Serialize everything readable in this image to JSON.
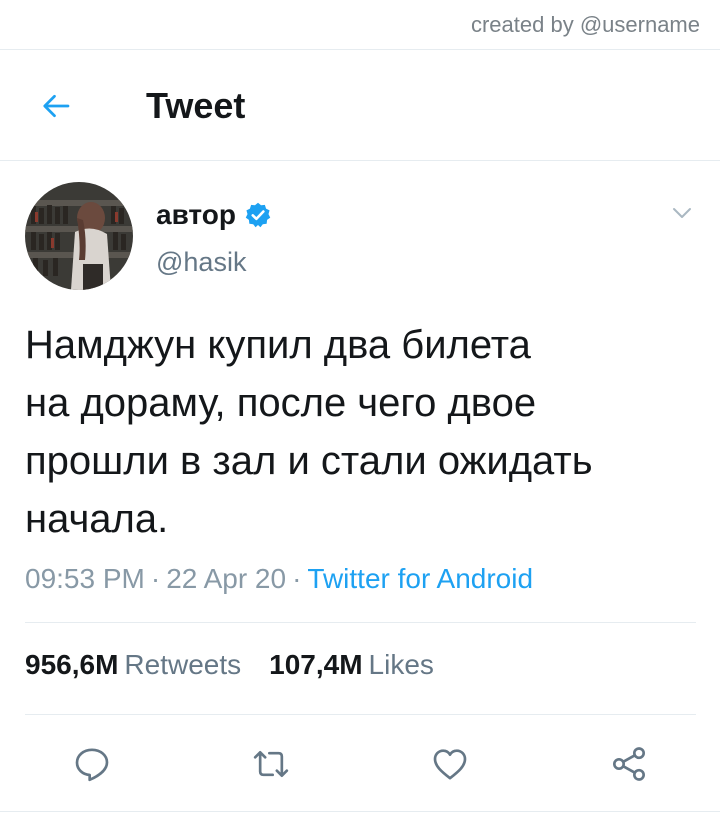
{
  "credit": "created by @username",
  "header": {
    "title": "Tweet",
    "back_icon": "arrow-left-icon"
  },
  "tweet": {
    "author": {
      "name": "автор",
      "handle": "@hasik",
      "verified": true
    },
    "text_lines": [
      "Намджун купил два билета",
      "на дораму, после чего двое",
      "прошли в зал и стали ожидать",
      "начала."
    ],
    "time": "09:53 PM",
    "date": "22 Apr 20",
    "separator": "·",
    "client": "Twitter for Android",
    "retweets_count": "956,6M",
    "retweets_label": "Retweets",
    "likes_count": "107,4M",
    "likes_label": "Likes"
  },
  "actions": [
    "reply-icon",
    "retweet-icon",
    "like-icon",
    "share-icon"
  ],
  "colors": {
    "accent": "#1da1f2",
    "text": "#14171a",
    "secondary": "#657786",
    "divider": "#e6ecf0"
  }
}
